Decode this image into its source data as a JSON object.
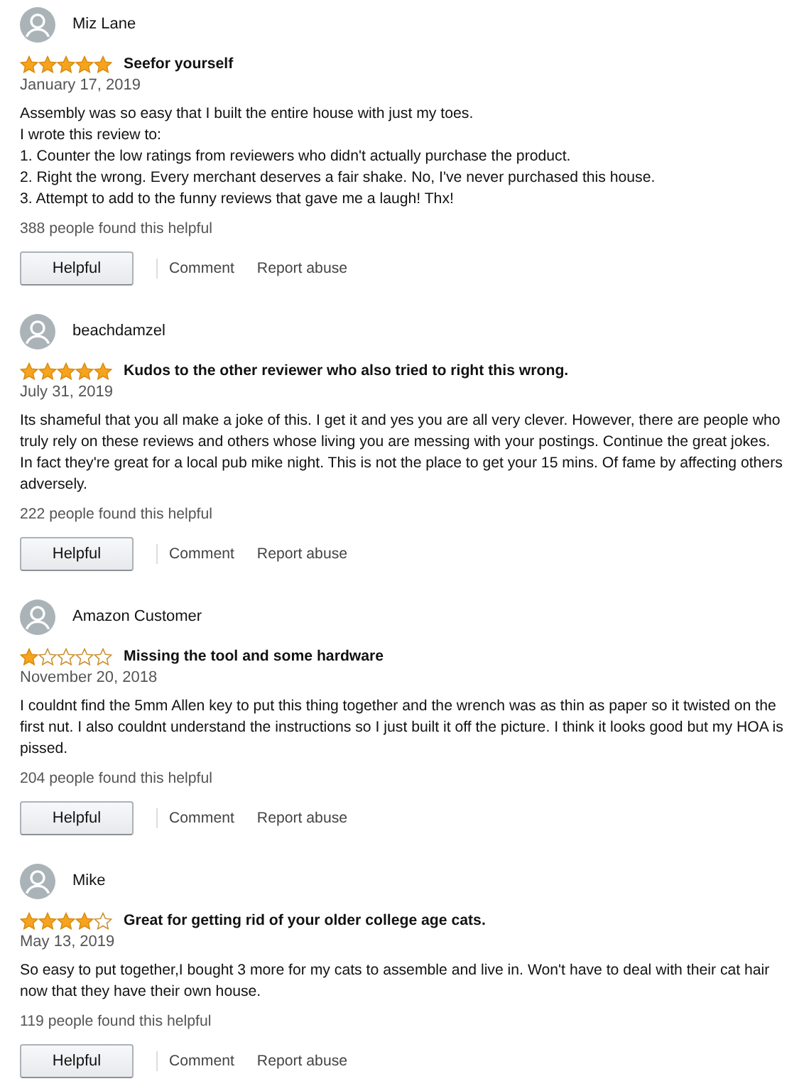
{
  "reviews": [
    {
      "author": "Miz Lane",
      "stars": 5,
      "title": "Seefor yourself",
      "date": "January 17, 2019",
      "body": [
        "Assembly was so easy that I built the entire house with just my toes.",
        "I wrote this review to:",
        "1. Counter the low ratings from reviewers who didn't actually purchase the product.",
        "2. Right the wrong. Every merchant deserves a fair shake. No, I've never purchased this house.",
        "3. Attempt to add to the funny reviews that gave me a laugh! Thx!"
      ],
      "helpful_count": "388 people found this helpful",
      "actions": [
        "Helpful",
        "Comment",
        "Report abuse"
      ]
    },
    {
      "author": "beachdamzel",
      "stars": 5,
      "title": "Kudos to the other reviewer who also tried to right this wrong.",
      "date": "July 31, 2019",
      "body": [
        "Its shameful that you all make a joke of this. I get it and yes you are all very clever. However, there are people who truly rely on these reviews and others whose living you are messing with your postings. Continue the great jokes. In fact they're great for a local pub mike night. This is not the place to get your 15 mins. Of fame by affecting others adversely."
      ],
      "helpful_count": "222 people found this helpful",
      "actions": [
        "Helpful",
        "Comment",
        "Report abuse"
      ]
    },
    {
      "author": "Amazon Customer",
      "stars": 1,
      "title": "Missing the tool and some hardware",
      "date": "November 20, 2018",
      "body": [
        "I couldnt find the 5mm Allen key to put this thing together and the wrench was as thin as paper so it twisted on the first nut. I also couldnt understand the instructions so I just built it off the picture. I think it looks good but my HOA is pissed."
      ],
      "helpful_count": "204 people found this helpful",
      "actions": [
        "Helpful",
        "Comment",
        "Report abuse"
      ]
    },
    {
      "author": "Mike",
      "stars": 4,
      "title": "Great for getting rid of your older college age cats.",
      "date": "May 13, 2019",
      "body": [
        "So easy to put together,I bought 3 more for my cats to assemble and live in. Won't have to deal with their cat hair now that they have their own house."
      ],
      "helpful_count": "119 people found this helpful",
      "actions": [
        "Helpful",
        "Comment",
        "Report abuse"
      ]
    }
  ]
}
